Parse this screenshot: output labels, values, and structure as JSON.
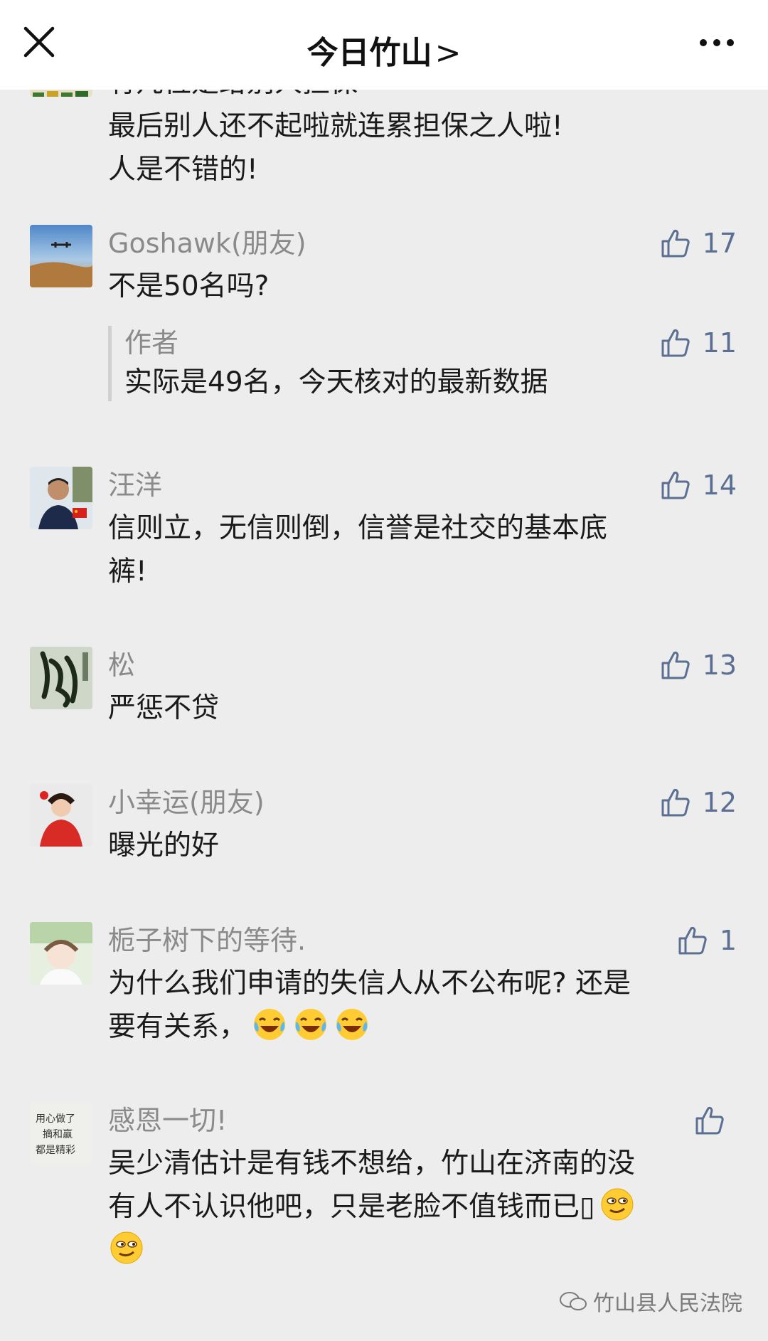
{
  "header": {
    "close_icon": "close-icon",
    "title": "今日竹山",
    "title_chevron": ">",
    "more_icon": "more-icon"
  },
  "partial_comment": {
    "lines": [
      "有几位是给别人担保",
      "最后别人还不起啦就连累担保之人啦!",
      "人是不错的!"
    ]
  },
  "comments": [
    {
      "nick": "Goshawk(朋友)",
      "text": "不是50名吗?",
      "likes": "17",
      "reply": {
        "author": "作者",
        "text": "实际是49名，今天核对的最新数据",
        "likes": "11"
      }
    },
    {
      "nick": "汪洋",
      "text_line1": "信则立，无信则倒，信誉是社交的基本底",
      "text_line2": "裤!",
      "likes": "14"
    },
    {
      "nick": "松",
      "text": "严惩不贷",
      "likes": "13"
    },
    {
      "nick": "小幸运(朋友)",
      "text": "曝光的好",
      "likes": "12"
    },
    {
      "nick": "栀子树下的等待.",
      "text_line1": "为什么我们申请的失信人从不公布呢? 还是",
      "text_line2": "要有关系，",
      "likes": "1",
      "emoji": "tears-of-joy-emoji"
    },
    {
      "nick": "感恩一切!",
      "text_line1": "吴少清估计是有钱不想给，竹山在济南的没",
      "text_line2": "有人不认识他吧，只是老脸不值钱而已",
      "text_line2_mark": "▯",
      "likes": "",
      "emoji": "smirk-emoji"
    }
  ],
  "avatar_text": {
    "comment_5": "用心做了 摘和赢 都是精彩"
  },
  "watermark": {
    "icon": "wechat-icon",
    "text": "竹山县人民法院"
  },
  "colors": {
    "background": "#ededed",
    "header_bg": "#ffffff",
    "nickname": "#8a8a8a",
    "like": "#5a6f91"
  }
}
